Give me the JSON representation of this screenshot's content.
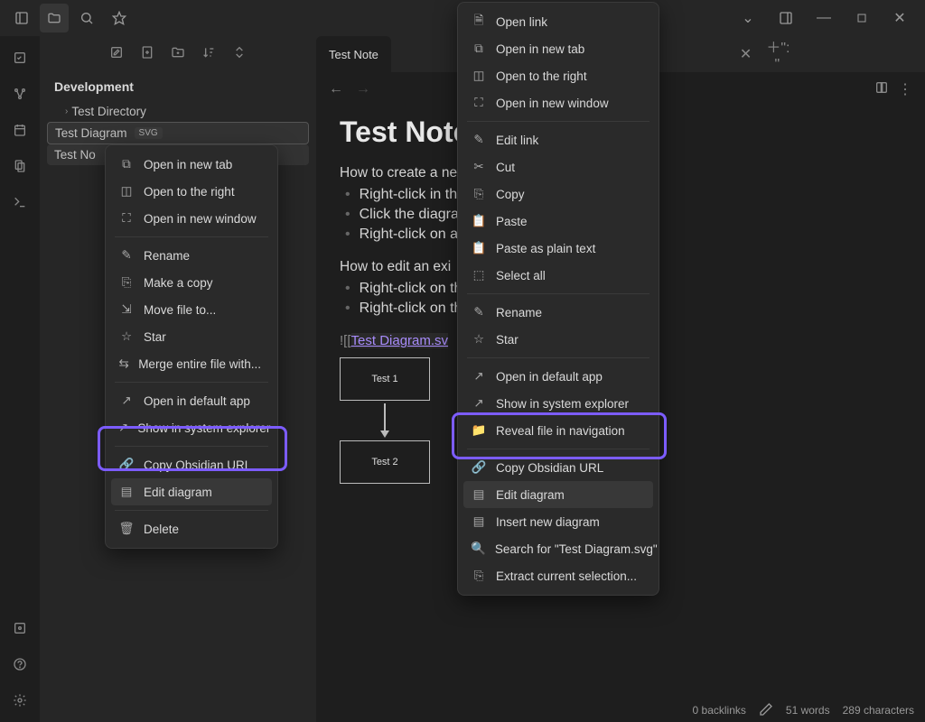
{
  "titlebar": {},
  "sidebar": {
    "vault": "Development",
    "items": [
      {
        "label": "Test Directory"
      },
      {
        "label": "Test Diagram",
        "badge": "SVG"
      },
      {
        "label": "Test No"
      }
    ]
  },
  "tabs": {
    "active": "Test Note"
  },
  "note": {
    "title": "Test Note",
    "p1": "How to create a ne",
    "b1": "Right-click in the",
    "b2": "Click the diagra",
    "b3": "Right-click on a",
    "p2": "How to edit an exi",
    "b4": "Right-click on th",
    "b5": "Right-click on th",
    "embed_bang": "![[",
    "embed_link": "Test Diagram.sv",
    "dg1": "Test 1",
    "dg2": "Test 2"
  },
  "status": {
    "backlinks": "0 backlinks",
    "words": "51 words",
    "chars": "289 characters"
  },
  "menu1": {
    "open_tab": "Open in new tab",
    "open_right": "Open to the right",
    "open_window": "Open in new window",
    "rename": "Rename",
    "copy": "Make a copy",
    "move": "Move file to...",
    "star": "Star",
    "merge": "Merge entire file with...",
    "default_app": "Open in default app",
    "explorer": "Show in system explorer",
    "copy_url": "Copy Obsidian URL",
    "edit_diagram": "Edit diagram",
    "delete": "Delete"
  },
  "menu2": {
    "open_link": "Open link",
    "open_tab": "Open in new tab",
    "open_right": "Open to the right",
    "open_window": "Open in new window",
    "edit_link": "Edit link",
    "cut": "Cut",
    "copy": "Copy",
    "paste": "Paste",
    "paste_plain": "Paste as plain text",
    "select_all": "Select all",
    "rename": "Rename",
    "star": "Star",
    "default_app": "Open in default app",
    "explorer": "Show in system explorer",
    "reveal": "Reveal file in navigation",
    "copy_url": "Copy Obsidian URL",
    "edit_diagram": "Edit diagram",
    "insert_diagram": "Insert new diagram",
    "search": "Search for \"Test Diagram.svg\"",
    "extract": "Extract current selection..."
  }
}
